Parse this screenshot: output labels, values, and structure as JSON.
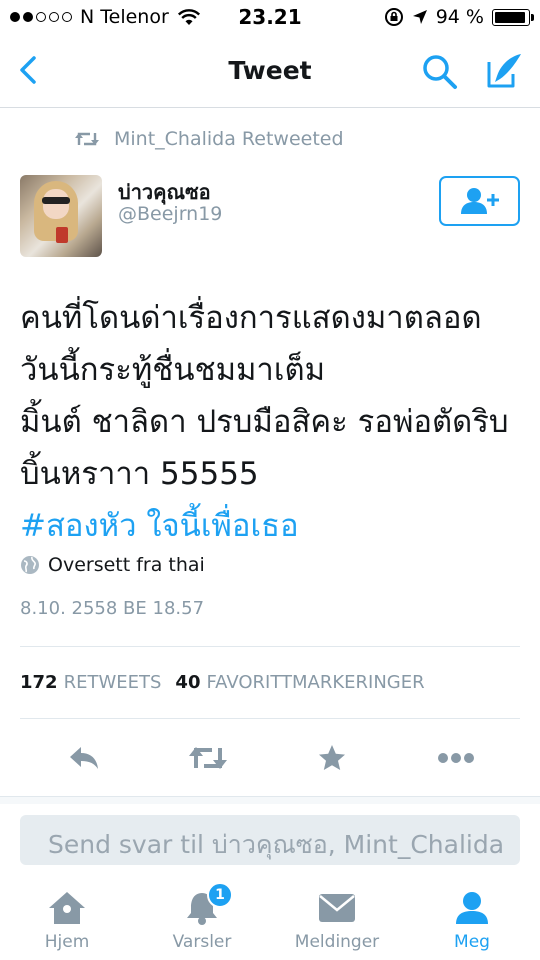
{
  "status_bar": {
    "carrier": "N Telenor",
    "time": "23.21",
    "battery_percent": "94 %",
    "battery_level": 0.94
  },
  "nav": {
    "title": "Tweet",
    "icons": [
      "back-chevron-icon",
      "search-icon",
      "compose-icon"
    ]
  },
  "retweet_context": "Mint_Chalida Retweeted",
  "author": {
    "name": "บ่าวคุณซอ",
    "handle": "@Beejrn19"
  },
  "tweet": {
    "lines": [
      "คนที่โดนด่าเรื่องการแสดงมาตลอด",
      "วันนี้กระทู้ชื่นชมมาเต็ม",
      "มิ้นต์ ชาลิดา ปรบมือสิคะ รอพ่อตัดริบ",
      "บิ้นหราาา 55555"
    ],
    "hashtag": "#สองหัว ใจนี้เพื่อเธอ",
    "translated_label": "Oversett fra thai",
    "timestamp": "8.10. 2558 BE 18.57"
  },
  "stats": {
    "retweets_count": "172",
    "retweets_label": "RETWEETS",
    "favorites_count": "40",
    "favorites_label": "FAVORITTMARKERINGER"
  },
  "actions": [
    "reply-icon",
    "retweet-icon",
    "favorite-icon",
    "more-icon"
  ],
  "reply_box": {
    "placeholder": "Send svar til บ่าวคุณซอ, Mint_Chalida"
  },
  "tabs": [
    {
      "label": "Hjem",
      "icon": "home-icon",
      "active": false
    },
    {
      "label": "Varsler",
      "icon": "notifications-icon",
      "active": false,
      "badge": "1"
    },
    {
      "label": "Meldinger",
      "icon": "messages-icon",
      "active": false
    },
    {
      "label": "Meg",
      "icon": "profile-icon",
      "active": true
    }
  ],
  "colors": {
    "accent": "#1da1f2",
    "muted": "#8899a6",
    "text": "#14171a"
  }
}
